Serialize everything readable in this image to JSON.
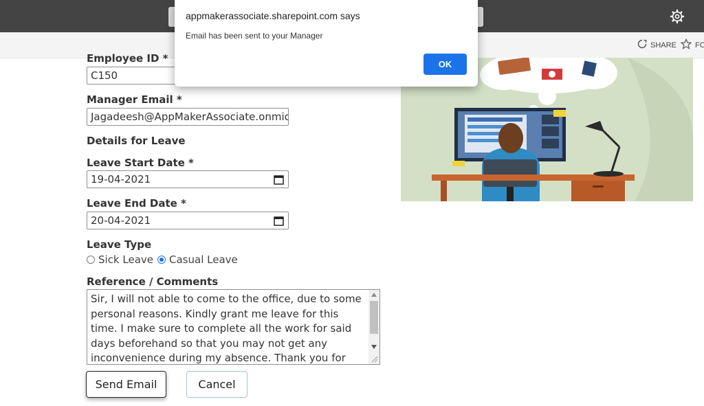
{
  "header": {
    "gear_icon": "gear-icon",
    "commands": {
      "share": "SHARE",
      "follow": "FOLLOW"
    }
  },
  "form": {
    "employee_id": {
      "label": "Employee ID *",
      "value": "C150"
    },
    "manager_email": {
      "label": "Manager Email *",
      "value": "Jagadeesh@AppMakerAssociate.onmicrosoft.com"
    },
    "section_heading": "Details for Leave",
    "leave_start": {
      "label": "Leave Start Date *",
      "value": "19-04-2021"
    },
    "leave_end": {
      "label": "Leave End Date *",
      "value": "20-04-2021"
    },
    "leave_type": {
      "label": "Leave Type",
      "options": [
        "Sick Leave",
        "Casual Leave"
      ],
      "selected": "Casual Leave"
    },
    "comments": {
      "label": "Reference / Comments",
      "value": "Sir, I will not able to come to the office, due to some personal reasons. Kindly grant me leave for this time. I make sure to complete all the work for said days beforehand so that you may not get any inconvenience during my absence. Thank you for"
    },
    "send_label": "Send Email",
    "cancel_label": "Cancel"
  },
  "dialog": {
    "title": "appmakerassociate.sharepoint.com says",
    "message": "Email has been sent to your Manager",
    "ok_label": "OK"
  },
  "colors": {
    "topbar": "#444444",
    "accent": "#1a73e8"
  }
}
